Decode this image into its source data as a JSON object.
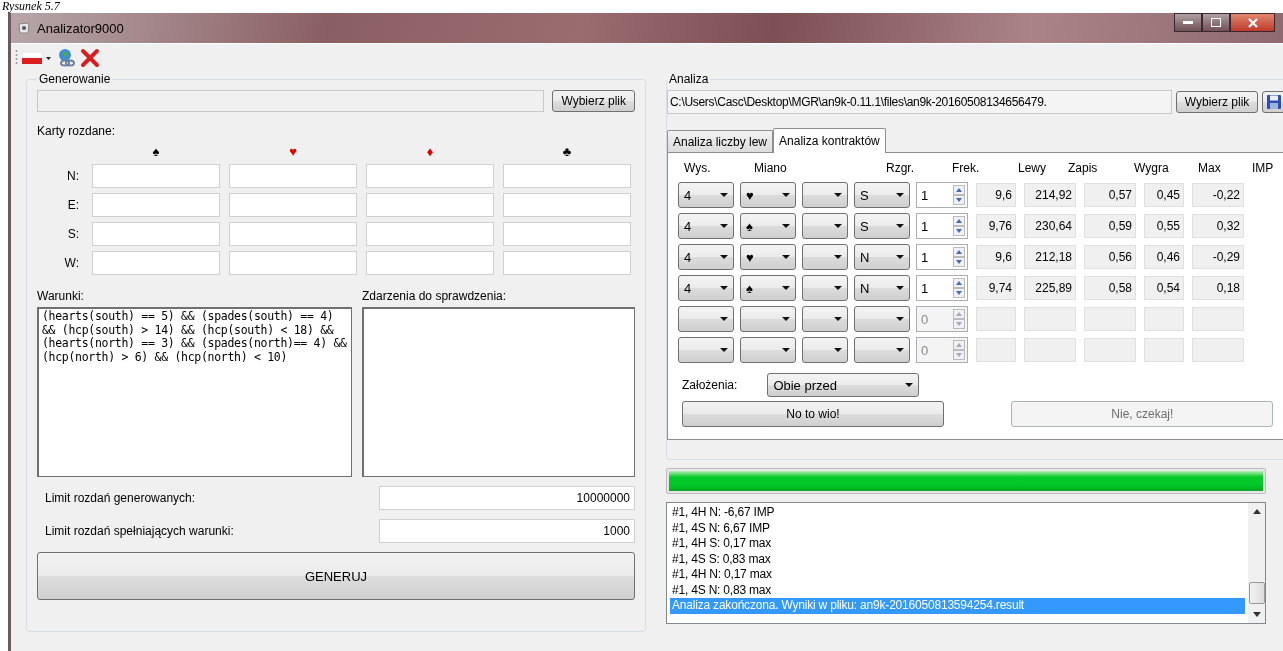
{
  "caption": "Rysunek 5.7",
  "window": {
    "title": "Analizator9000"
  },
  "generation": {
    "title": "Generowanie",
    "choose_button": "Wybierz plik",
    "cards_label": "Karty rozdane:",
    "suits": [
      {
        "symbol": "♠",
        "color": "#000000"
      },
      {
        "symbol": "♥",
        "color": "#e00000"
      },
      {
        "symbol": "♦",
        "color": "#e00000"
      },
      {
        "symbol": "♣",
        "color": "#000000"
      }
    ],
    "hands": [
      {
        "player": "N:"
      },
      {
        "player": "E:"
      },
      {
        "player": "S:"
      },
      {
        "player": "W:"
      }
    ],
    "conditions_label": "Warunki:",
    "conditions": "(hearts(south) == 5) && (spades(south) == 4) && (hcp(south) > 14) && (hcp(south) < 18) && (hearts(north) == 3) && (spades(north)== 4) && (hcp(north) > 6) && (hcp(north) < 10)",
    "events_label": "Zdarzenia do sprawdzenia:",
    "limits": [
      {
        "label": "Limit rozdań generowanych:",
        "value": "10000000"
      },
      {
        "label": "Limit rozdań spełniających warunki:",
        "value": "1000"
      }
    ],
    "generate_button": "GENERUJ"
  },
  "analysis": {
    "title": "Analiza",
    "file_path": "C:\\Users\\Casc\\Desktop\\MGR\\an9k-0.11.1\\files\\an9k-20160508134656479.",
    "choose_button": "Wybierz plik",
    "tabs": [
      {
        "label": "Analiza liczby lew",
        "selected": false
      },
      {
        "label": "Analiza kontraktów",
        "selected": true
      }
    ],
    "columns": [
      "Wys.",
      "Miano",
      "Rzgr.",
      "Frek.",
      "Lewy",
      "Zapis",
      "Wygra",
      "Max",
      "IMP"
    ],
    "rows": [
      {
        "disabled": false,
        "level_value": "4",
        "denomination": "♥",
        "declarer": "S",
        "frequency": "1",
        "tricks": "9,6",
        "score": "214,92",
        "win": "0,57",
        "max": "0,45",
        "imp": "-0,22"
      },
      {
        "disabled": false,
        "level_value": "4",
        "denomination": "♠",
        "declarer": "S",
        "frequency": "1",
        "tricks": "9,76",
        "score": "230,64",
        "win": "0,59",
        "max": "0,55",
        "imp": "0,32"
      },
      {
        "disabled": false,
        "level_value": "4",
        "denomination": "♥",
        "declarer": "N",
        "frequency": "1",
        "tricks": "9,6",
        "score": "212,18",
        "win": "0,56",
        "max": "0,46",
        "imp": "-0,29"
      },
      {
        "disabled": false,
        "level_value": "4",
        "denomination": "♠",
        "declarer": "N",
        "frequency": "1",
        "tricks": "9,74",
        "score": "225,89",
        "win": "0,58",
        "max": "0,54",
        "imp": "0,18"
      },
      {
        "disabled": true,
        "frequency": "0"
      },
      {
        "disabled": true,
        "frequency": "0"
      }
    ],
    "assumptions_label": "Założenia:",
    "assumptions_value": "Obie przed",
    "run_button": {
      "label": "No to wio!",
      "disabled": false
    },
    "stop_button": {
      "label": "Nie, czekaj!",
      "disabled": true
    },
    "progress": {
      "level": 1
    },
    "log": [
      {
        "text": "#1, 4H N: -6,67 IMP",
        "selected": false
      },
      {
        "text": "#1, 4S N: 6,67 IMP",
        "selected": false
      },
      {
        "text": "#1, 4H S: 0,17 max",
        "selected": false
      },
      {
        "text": "#1, 4S S: 0,83 max",
        "selected": false
      },
      {
        "text": "#1, 4H N: 0,17 max",
        "selected": false
      },
      {
        "text": "#1, 4S N: 0,83 max",
        "selected": false
      },
      {
        "text": "Analiza zakończona. Wyniki w pliku: an9k-2016050813594254.result",
        "selected": true
      }
    ]
  }
}
